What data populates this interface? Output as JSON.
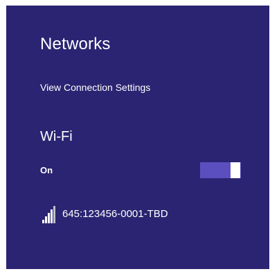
{
  "panel": {
    "title": "Networks",
    "connection_settings_link": "View Connection Settings"
  },
  "wifi": {
    "section_title": "Wi-Fi",
    "state_label": "On",
    "enabled": true,
    "toggle_icon": "toggle-switch-on"
  },
  "networks": [
    {
      "name": "645:123456-0001-TBD",
      "signal_icon": "wifi-signal-bars-icon"
    }
  ],
  "colors": {
    "panel_background": "#2b2472",
    "toggle_accent": "#5b4fc0",
    "text": "#ffffff"
  }
}
